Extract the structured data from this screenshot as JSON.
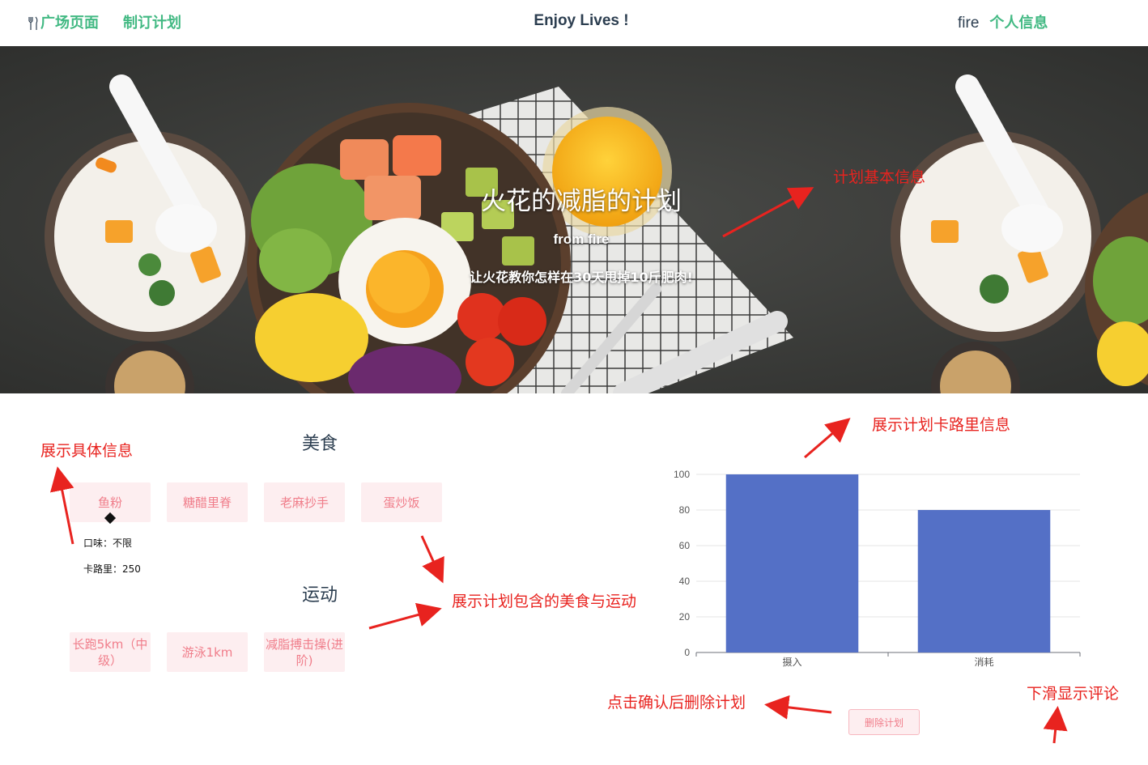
{
  "nav": {
    "links": [
      "广场页面",
      "制订计划"
    ],
    "title": "Enjoy Lives !",
    "user": "fire",
    "profile": "个人信息"
  },
  "hero": {
    "plan_name": "火花的减脂的计划",
    "from": "from fire",
    "description": "让火花教你怎样在30天甩掉10斤肥肉!"
  },
  "food": {
    "title": "美食",
    "items": [
      "鱼粉",
      "糖醋里脊",
      "老麻抄手",
      "蛋炒饭"
    ],
    "tooltip": {
      "taste": "口味：不限",
      "calories": "卡路里：250"
    }
  },
  "sport": {
    "title": "运动",
    "items": [
      "长跑5km（中级）",
      "游泳1km",
      "减脂搏击操(进阶)"
    ]
  },
  "chart_data": {
    "type": "bar",
    "categories": [
      "摄入",
      "消耗"
    ],
    "values": [
      100,
      80
    ],
    "ylim": [
      0,
      100
    ],
    "yticks": [
      0,
      20,
      40,
      60,
      80,
      100
    ],
    "grid": true,
    "bar_color": "#5470c6"
  },
  "actions": {
    "delete": "删除计划"
  },
  "annotations": {
    "plan_basic": "计划基本信息",
    "detail": "展示具体信息",
    "calorie": "展示计划卡路里信息",
    "contains": "展示计划包含的美食与运动",
    "delete_hint": "点击确认后删除计划",
    "scroll_hint": "下滑显示评论"
  },
  "colors": {
    "accent": "#42b983",
    "annotation": "#e8231f",
    "tag_bg": "#fdeef0",
    "tag_text": "#f07d8a"
  }
}
